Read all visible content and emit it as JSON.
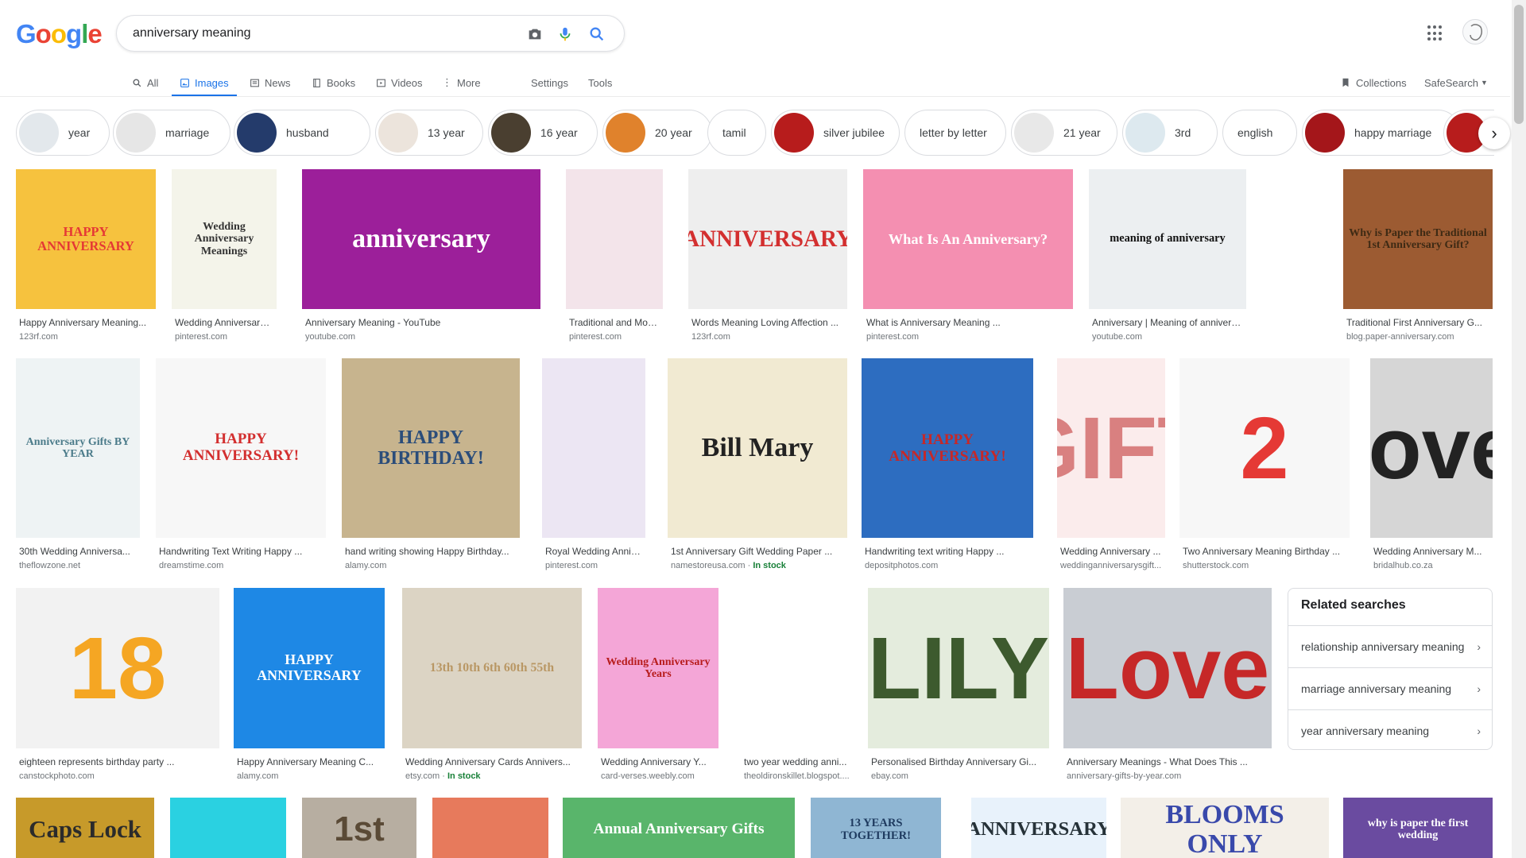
{
  "search": {
    "query": "anniversary meaning"
  },
  "tabs": [
    {
      "label": "All",
      "icon": "search-icon"
    },
    {
      "label": "Images",
      "icon": "image-icon",
      "active": true
    },
    {
      "label": "News",
      "icon": "news-icon"
    },
    {
      "label": "Books",
      "icon": "book-icon"
    },
    {
      "label": "Videos",
      "icon": "video-icon"
    },
    {
      "label": "More",
      "icon": "more-vert-icon"
    },
    {
      "label": "Settings"
    },
    {
      "label": "Tools"
    }
  ],
  "header_right": {
    "collections": "Collections",
    "safesearch": "SafeSearch"
  },
  "chips": [
    {
      "label": "year",
      "thumb": "#e3e8ec"
    },
    {
      "label": "marriage",
      "thumb": "#e6e6e6"
    },
    {
      "label": "husband",
      "thumb": "#243b6b"
    },
    {
      "label": "13 year",
      "thumb": "#ece4dc"
    },
    {
      "label": "16 year",
      "thumb": "#4a3f30"
    },
    {
      "label": "20 year",
      "thumb": "#e0822c"
    },
    {
      "label": "tamil"
    },
    {
      "label": "silver jubilee",
      "thumb": "#b71c1c"
    },
    {
      "label": "letter by letter"
    },
    {
      "label": "21 year",
      "thumb": "#e8e8e8"
    },
    {
      "label": "3rd",
      "thumb": "#dde9ef"
    },
    {
      "label": "english"
    },
    {
      "label": "happy marriage",
      "thumb": "#a4161a"
    },
    {
      "label": "",
      "thumb": "#b71c1c"
    }
  ],
  "rows": [
    [
      {
        "title": "Happy Anniversary Meaning...",
        "source": "123rf.com",
        "bg": "#f6c23e",
        "text": "HAPPY ANNIVERSARY",
        "fg": "#e53935"
      },
      {
        "title": "Wedding Anniversary ...",
        "source": "pinterest.com",
        "bg": "#f4f4ea",
        "text": "Wedding Anniversary Meanings",
        "fg": "#333333"
      },
      {
        "title": "Anniversary Meaning - YouTube",
        "source": "youtube.com",
        "bg": "#9c1f9a",
        "text": "anniversary",
        "fg": "#ffffff"
      },
      {
        "title": "Traditional and Moder...",
        "source": "pinterest.com",
        "bg": "#f3e4ea",
        "text": "",
        "fg": "#333333"
      },
      {
        "title": "Words Meaning Loving Affection ...",
        "source": "123rf.com",
        "bg": "#eeeeee",
        "text": "ANNIVERSARY",
        "fg": "#d32f2f"
      },
      {
        "title": "What is Anniversary Meaning ...",
        "source": "pinterest.com",
        "bg": "#f48fb1",
        "text": "What Is An Anniversary?",
        "fg": "#ffffff"
      },
      {
        "title": "Anniversary | Meaning of anniversary ...",
        "source": "youtube.com",
        "bg": "#eceff1",
        "text": "meaning of anniversary",
        "fg": "#111111"
      },
      {
        "title": "Traditional First Anniversary G...",
        "source": "blog.paper-anniversary.com",
        "bg": "#9c5b32",
        "text": "Why is Paper the Traditional 1st Anniversary Gift?",
        "fg": "#3e2a14"
      }
    ],
    [
      {
        "title": "30th Wedding Anniversa...",
        "source": "theflowzone.net",
        "bg": "#eef3f4",
        "text": "Anniversary Gifts BY YEAR",
        "fg": "#4b7b8a"
      },
      {
        "title": "Handwriting Text Writing Happy ...",
        "source": "dreamstime.com",
        "bg": "#f7f7f7",
        "text": "HAPPY ANNIVERSARY!",
        "fg": "#d32f2f"
      },
      {
        "title": "hand writing showing Happy Birthday...",
        "source": "alamy.com",
        "bg": "#c7b48e",
        "text": "HAPPY BIRTHDAY!",
        "fg": "#2b4d7a"
      },
      {
        "title": "Royal Wedding Annive...",
        "source": "pinterest.com",
        "bg": "#ece6f3",
        "text": "",
        "fg": "#333333"
      },
      {
        "title": "1st Anniversary Gift Wedding Paper ...",
        "source": "namestoreusa.com",
        "stock": "In stock",
        "bg": "#f1ead2",
        "text": "Bill Mary",
        "fg": "#222222"
      },
      {
        "title": "Handwriting text writing Happy ...",
        "source": "depositphotos.com",
        "bg": "#2d6dc0",
        "text": "HAPPY ANNIVERSARY!",
        "fg": "#c62828"
      },
      {
        "title": "Wedding Anniversary ...",
        "source": "weddinganniversarysgift...",
        "bg": "#fbecec",
        "text": "GIFT",
        "fg": "#d98080"
      },
      {
        "title": "Two Anniversary Meaning Birthday ...",
        "source": "shutterstock.com",
        "bg": "#f7f7f7",
        "text": "2",
        "fg": "#e53935"
      },
      {
        "title": "Wedding Anniversary M...",
        "source": "bridalhub.co.za",
        "bg": "#d6d6d6",
        "text": "love",
        "fg": "#222222"
      }
    ],
    [
      {
        "title": "eighteen represents birthday party ...",
        "source": "canstockphoto.com",
        "bg": "#f2f2f2",
        "text": "18",
        "fg": "#f5a623"
      },
      {
        "title": "Happy Anniversary Meaning C...",
        "source": "alamy.com",
        "bg": "#1e88e5",
        "text": "HAPPY ANNIVERSARY",
        "fg": "#ffffff"
      },
      {
        "title": "Wedding Anniversary Cards Annivers...",
        "source": "etsy.com",
        "stock": "In stock",
        "bg": "#dcd4c4",
        "text": "13th 10th 6th 60th 55th",
        "fg": "#b99764"
      },
      {
        "title": "Wedding Anniversary Y...",
        "source": "card-verses.weebly.com",
        "bg": "#f4a6d7",
        "text": "Wedding Anniversary Years",
        "fg": "#b71c1c"
      },
      {
        "title": "two year wedding anni...",
        "source": "theoldironskillet.blogspot....",
        "bg": "#ffffff",
        "text": "",
        "fg": "#222222"
      },
      {
        "title": "Personalised Birthday Anniversary Gi...",
        "source": "ebay.com",
        "bg": "#e4ecdd",
        "text": "LILY",
        "fg": "#3d5a2e"
      },
      {
        "title": "Anniversary Meanings - What Does This ...",
        "source": "anniversary-gifts-by-year.com",
        "bg": "#c9cdd3",
        "text": "Love",
        "fg": "#c62828"
      }
    ],
    [
      {
        "bg": "#c79a2a",
        "text": "Caps Lock",
        "fg": "#2b2b2b"
      },
      {
        "bg": "#2ad1e1",
        "text": "",
        "fg": "#ffffff"
      },
      {
        "bg": "#b7aea1",
        "text": "1st",
        "fg": "#5a4a36"
      },
      {
        "bg": "#e77a5c",
        "text": "",
        "fg": "#ffffff"
      },
      {
        "bg": "#59b56b",
        "text": "Annual Anniversary Gifts",
        "fg": "#ffffff"
      },
      {
        "bg": "#8fb6d3",
        "text": "13 YEARS TOGETHER!",
        "fg": "#1e3a5f"
      },
      {
        "bg": "#e8f2fb",
        "text": "ANNIVERSARY",
        "fg": "#263238"
      },
      {
        "bg": "#f3efe8",
        "text": "BLOOMS ONLY",
        "fg": "#3949ab"
      },
      {
        "bg": "#6a4ba0",
        "text": "why is paper the first wedding",
        "fg": "#ffffff"
      }
    ]
  ],
  "related": {
    "title": "Related searches",
    "items": [
      "relationship anniversary meaning",
      "marriage anniversary meaning",
      "year anniversary meaning"
    ]
  }
}
